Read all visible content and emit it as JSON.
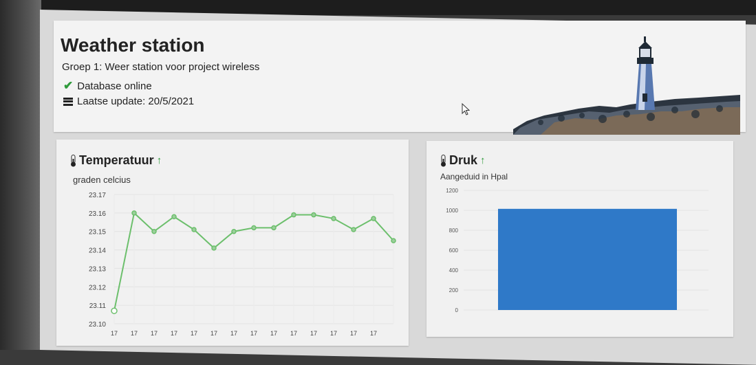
{
  "header": {
    "title": "Weather station",
    "subtitle": "Groep 1: Weer station voor project wireless",
    "status": "Database online",
    "last_update": "Laatse update: 20/5/2021"
  },
  "temperature": {
    "title": "Temperatuur",
    "unit_label": "graden celcius"
  },
  "pressure": {
    "title": "Druk",
    "unit_label": "Aangeduid in Hpal"
  },
  "colors": {
    "accent_green": "#2e9a3a",
    "line_series": "#6cbf6c",
    "bar_fill": "#2f79c8"
  },
  "chart_data": [
    {
      "type": "line",
      "y_ticks": [
        "23.17",
        "23.16",
        "23.15",
        "23.14",
        "23.13",
        "23.12",
        "23.11",
        "23.10"
      ],
      "ylim": [
        23.1,
        23.17
      ],
      "x": [
        "17",
        "17",
        "17",
        "17",
        "17",
        "17",
        "17",
        "17",
        "17",
        "17",
        "17",
        "17",
        "17",
        "17"
      ],
      "values": [
        23.107,
        23.16,
        23.15,
        23.158,
        23.151,
        23.141,
        23.15,
        23.152,
        23.152,
        23.159,
        23.159,
        23.157,
        23.151,
        23.157,
        23.145
      ],
      "grid": true
    },
    {
      "type": "bar",
      "y_ticks": [
        "1200",
        "1000",
        "800",
        "600",
        "400",
        "200",
        "0"
      ],
      "ylim": [
        0,
        1200
      ],
      "categories": [
        ""
      ],
      "values": [
        1015
      ],
      "grid": true
    }
  ]
}
